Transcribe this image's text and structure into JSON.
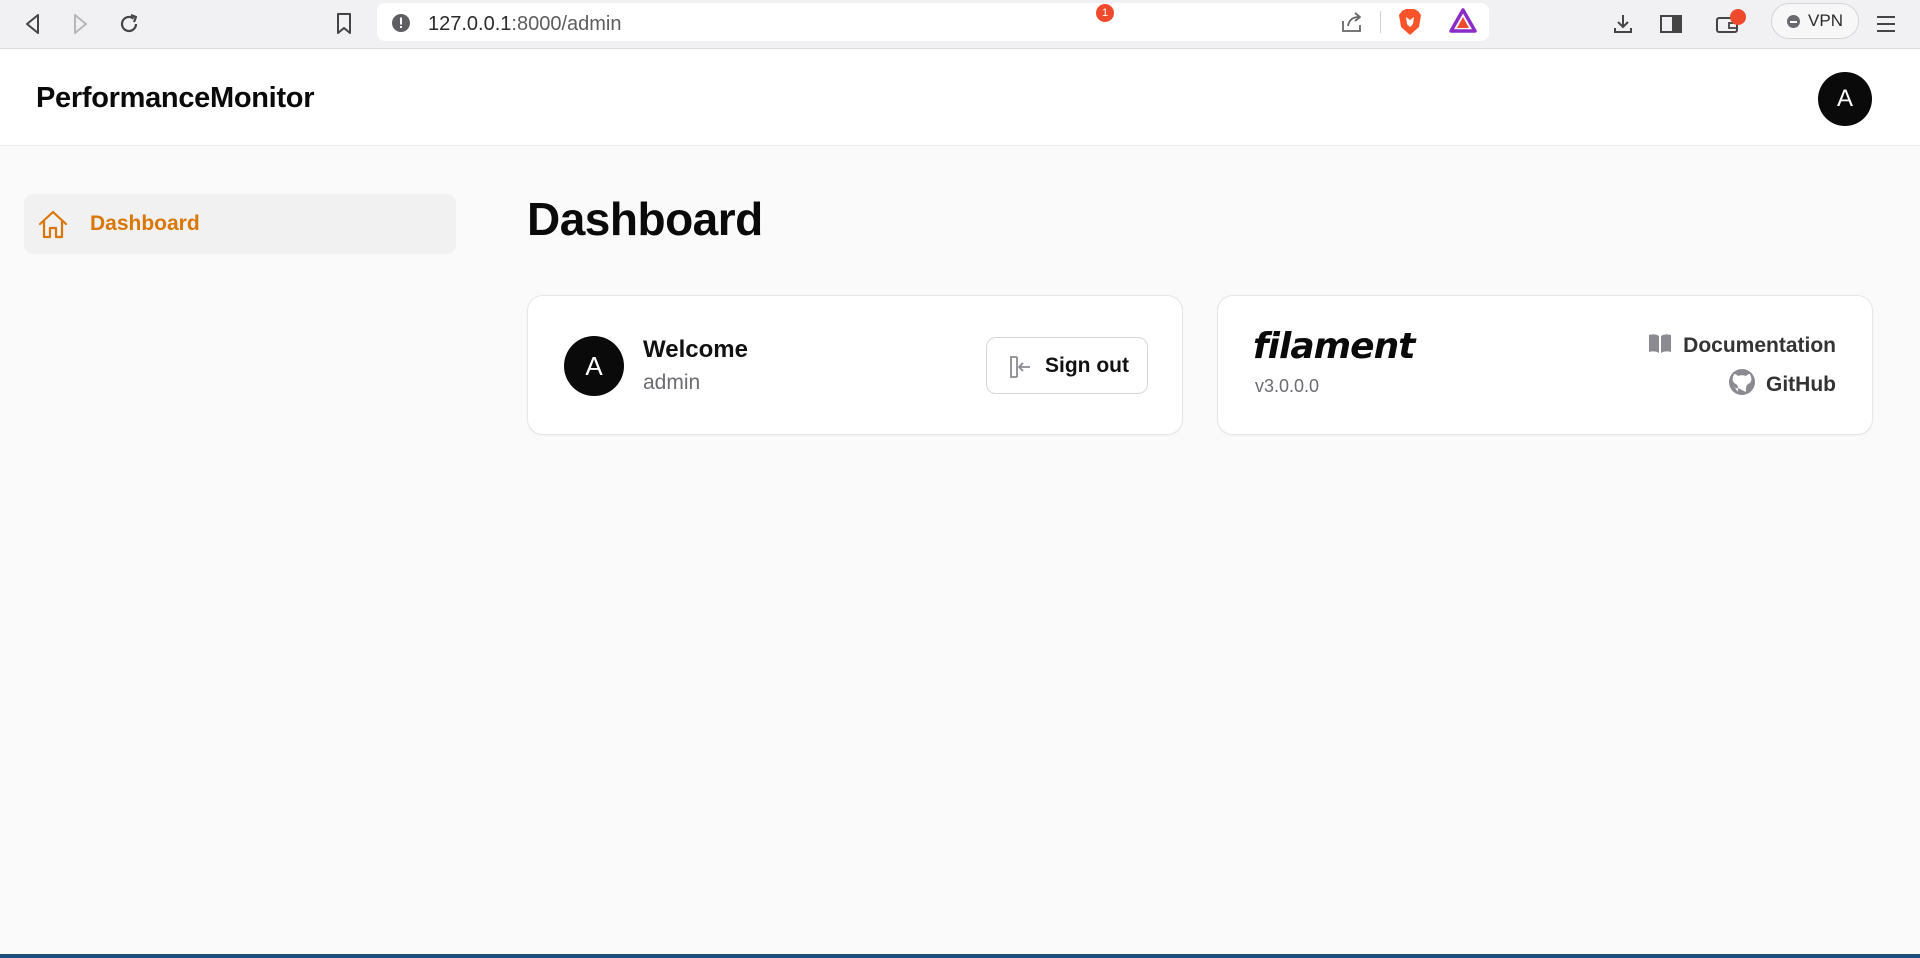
{
  "browser": {
    "url_host": "127.0.0.1",
    "url_path": ":8000/admin",
    "rewards_badge": "1",
    "vpn_label": "VPN"
  },
  "topbar": {
    "brand": "PerformanceMonitor",
    "avatar_initial": "A"
  },
  "sidebar": {
    "items": [
      {
        "label": "Dashboard",
        "icon": "home-icon",
        "active": true
      }
    ]
  },
  "main": {
    "title": "Dashboard",
    "welcome_card": {
      "avatar_initial": "A",
      "title": "Welcome",
      "username": "admin",
      "sign_out_label": "Sign out"
    },
    "filament_card": {
      "logo_text": "filament",
      "version": "v3.0.0.0",
      "documentation_label": "Documentation",
      "github_label": "GitHub"
    }
  },
  "colors": {
    "accent": "#d97706",
    "primary_text": "#0a0a0a",
    "muted_text": "#6b6b70",
    "background": "#fafafa"
  }
}
